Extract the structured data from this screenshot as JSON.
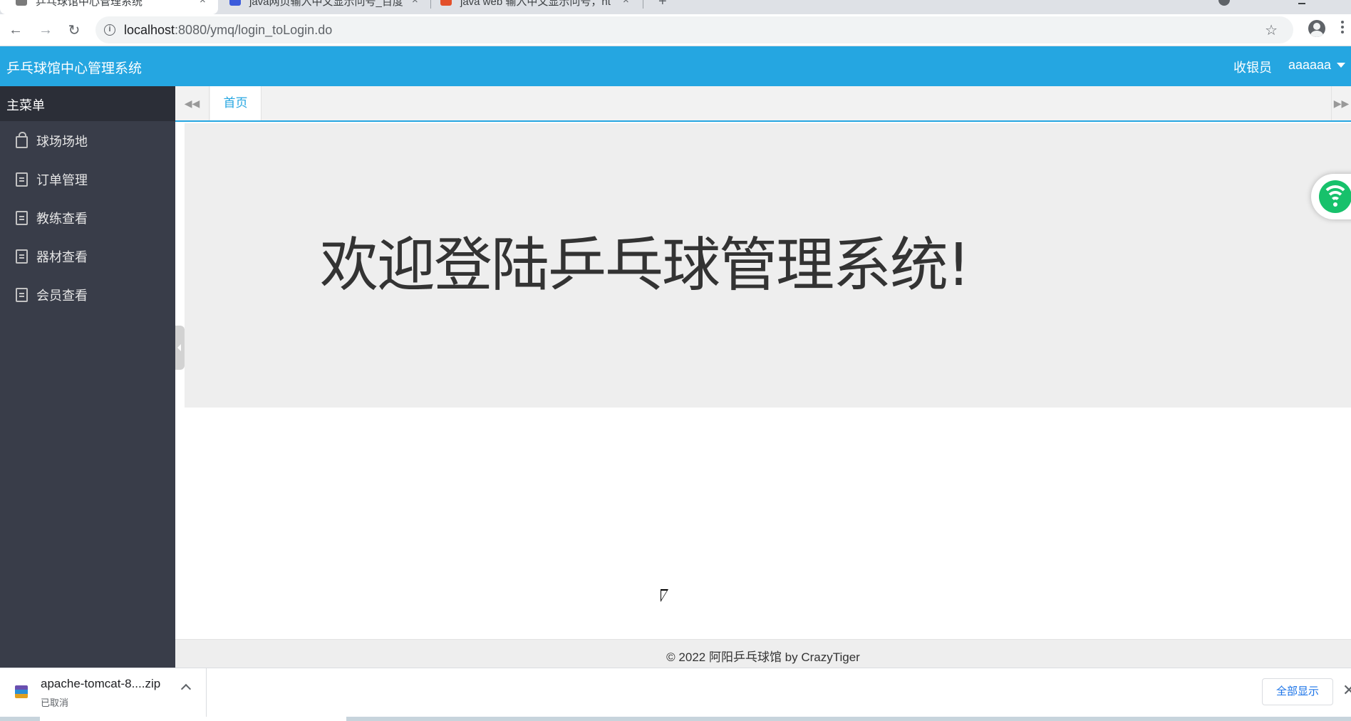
{
  "browser": {
    "tabs": [
      {
        "title": "乒乓球馆中心管理系统",
        "active": true
      },
      {
        "title": "java网页输入中文显示问号_百度",
        "active": false
      },
      {
        "title": "java web 输入中文显示问号，ht",
        "active": false
      }
    ],
    "tab_close_glyph": "×",
    "new_tab_glyph": "+",
    "url_host": "localhost",
    "url_path": ":8080/ymq/login_toLogin.do",
    "back_glyph": "←",
    "forward_glyph": "→",
    "reload_glyph": "↻",
    "star_glyph": "☆"
  },
  "header": {
    "title": "乒乓球馆中心管理系统",
    "role": "收银员",
    "user": "aaaaaa",
    "bg_color": "#25a6e1"
  },
  "sidebar": {
    "title": "主菜单",
    "items": [
      {
        "label": "球场场地",
        "icon": "bag-icon"
      },
      {
        "label": "订单管理",
        "icon": "document-icon"
      },
      {
        "label": "教练查看",
        "icon": "document-icon"
      },
      {
        "label": "器材查看",
        "icon": "document-icon"
      },
      {
        "label": "会员查看",
        "icon": "document-icon"
      }
    ],
    "bg_color": "#393d49"
  },
  "tabs": {
    "prev_glyph": "◀◀",
    "home_label": "首页",
    "next_glyph": "▶▶"
  },
  "main": {
    "welcome": "欢迎登陆乒乓球管理系统!"
  },
  "footer": {
    "text": "© 2022 阿阳乒乓球馆 by CrazyTiger"
  },
  "downloads": {
    "file_name": "apache-tomcat-8....zip",
    "status": "已取消",
    "show_all_label": "全部显示",
    "close_glyph": "✕"
  }
}
